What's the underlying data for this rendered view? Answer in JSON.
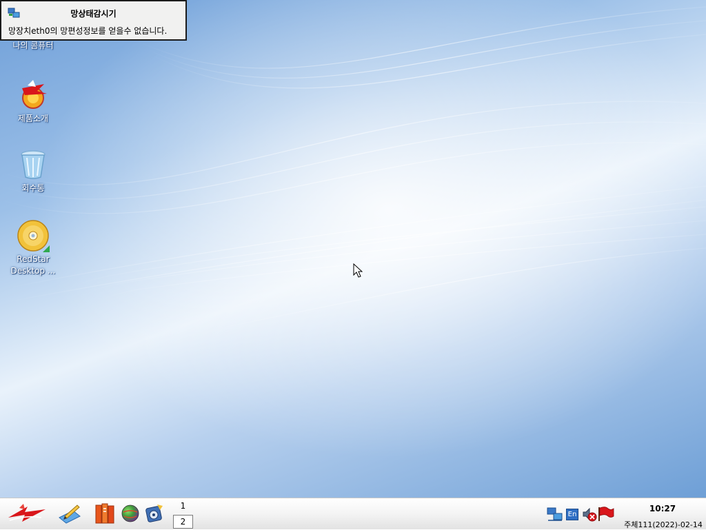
{
  "notification": {
    "title": "망상태감시기",
    "message": "망장치eth0의 망편성정보를 얻을수 없습니다.",
    "icon": "network-monitor-icon"
  },
  "desktop_icons": [
    {
      "label": "나의 콤퓨터",
      "icon": "computer-icon"
    },
    {
      "label": "제품소개",
      "icon": "product-intro-icon"
    },
    {
      "label": "회수통",
      "icon": "trash-bin-icon"
    },
    {
      "label": "RedStar\nDesktop ...",
      "icon": "cd-disc-icon"
    }
  ],
  "taskbar": {
    "launchers": [
      {
        "icon": "redstar-start-icon"
      },
      {
        "icon": "text-editor-icon"
      },
      {
        "icon": "office-suite-icon"
      },
      {
        "icon": "web-browser-globe-icon"
      },
      {
        "icon": "media-player-icon"
      }
    ],
    "workspaces": [
      "1",
      "2"
    ],
    "active_workspace": "2",
    "tray": [
      {
        "icon": "network-tray-icon"
      },
      {
        "icon": "input-method-en-icon",
        "text": "En"
      },
      {
        "icon": "volume-muted-icon"
      },
      {
        "icon": "red-flag-icon"
      }
    ],
    "clock_time": "10:27",
    "clock_date": "주체111(2022)-02-14"
  },
  "colors": {
    "desktop_blue": "#6f9fd8",
    "desktop_highlight": "#e9f2fb",
    "taskbar_bg": "#f4f4f4",
    "accent_red": "#d9161b"
  }
}
